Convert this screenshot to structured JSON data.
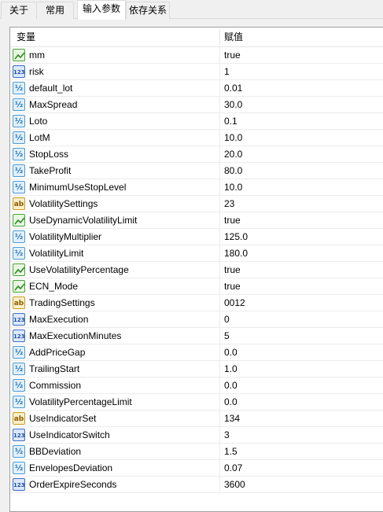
{
  "tabs": [
    {
      "label": "关于",
      "active": false
    },
    {
      "label": "常用",
      "active": false
    },
    {
      "label": "输入参数",
      "active": true
    },
    {
      "label": "依存关系",
      "active": false
    }
  ],
  "table": {
    "col_name": "变量",
    "col_value": "赋值",
    "rows": [
      {
        "type": "bool",
        "name": "mm",
        "value": "true"
      },
      {
        "type": "int",
        "name": "risk",
        "value": "1"
      },
      {
        "type": "dbl",
        "name": "default_lot",
        "value": "0.01"
      },
      {
        "type": "dbl",
        "name": "MaxSpread",
        "value": "30.0"
      },
      {
        "type": "dbl",
        "name": "Loto",
        "value": "0.1"
      },
      {
        "type": "dbl",
        "name": "LotM",
        "value": "10.0"
      },
      {
        "type": "dbl",
        "name": "StopLoss",
        "value": "20.0"
      },
      {
        "type": "dbl",
        "name": "TakeProfit",
        "value": "80.0"
      },
      {
        "type": "dbl",
        "name": "MinimumUseStopLevel",
        "value": "10.0"
      },
      {
        "type": "str",
        "name": "VolatilitySettings",
        "value": "23"
      },
      {
        "type": "bool",
        "name": "UseDynamicVolatilityLimit",
        "value": "true"
      },
      {
        "type": "dbl",
        "name": "VolatilityMultiplier",
        "value": "125.0"
      },
      {
        "type": "dbl",
        "name": "VolatilityLimit",
        "value": "180.0"
      },
      {
        "type": "bool",
        "name": "UseVolatilityPercentage",
        "value": "true"
      },
      {
        "type": "bool",
        "name": "ECN_Mode",
        "value": "true"
      },
      {
        "type": "str",
        "name": "TradingSettings",
        "value": "0012"
      },
      {
        "type": "int",
        "name": "MaxExecution",
        "value": "0"
      },
      {
        "type": "int",
        "name": "MaxExecutionMinutes",
        "value": "5"
      },
      {
        "type": "dbl",
        "name": "AddPriceGap",
        "value": "0.0"
      },
      {
        "type": "dbl",
        "name": "TrailingStart",
        "value": "1.0"
      },
      {
        "type": "dbl",
        "name": "Commission",
        "value": "0.0"
      },
      {
        "type": "dbl",
        "name": "VolatilityPercentageLimit",
        "value": "0.0"
      },
      {
        "type": "str",
        "name": "UseIndicatorSet",
        "value": "134"
      },
      {
        "type": "int",
        "name": "UseIndicatorSwitch",
        "value": "3"
      },
      {
        "type": "dbl",
        "name": "BBDeviation",
        "value": "1.5"
      },
      {
        "type": "dbl",
        "name": "EnvelopesDeviation",
        "value": "0.07"
      },
      {
        "type": "int",
        "name": "OrderExpireSeconds",
        "value": "3600"
      }
    ]
  },
  "icons": {
    "bool": "bool-icon",
    "int": "integer-icon",
    "dbl": "double-icon",
    "str": "string-icon"
  }
}
